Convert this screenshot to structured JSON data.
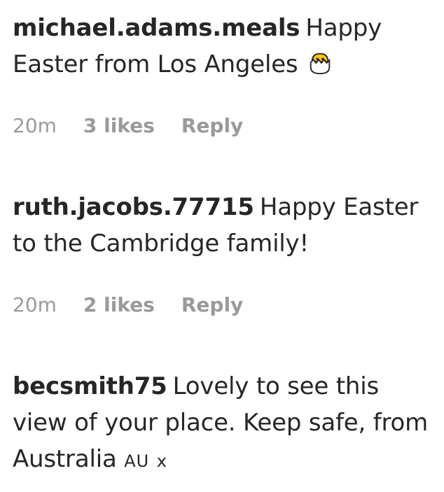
{
  "comments": [
    {
      "username": "michael.adams.meals",
      "text": "Happy Easter from Los Angeles",
      "emoji": "hatching-chick-icon",
      "time": "20m",
      "likes": "3 likes",
      "reply": "Reply"
    },
    {
      "username": "ruth.jacobs.77715",
      "text": "Happy Easter to the Cambridge family!",
      "time": "20m",
      "likes": "2 likes",
      "reply": "Reply"
    },
    {
      "username": "becsmith75",
      "text": "Lovely to see this view of your place. Keep safe, from Australia",
      "flag": "AU",
      "suffix": "x"
    }
  ]
}
